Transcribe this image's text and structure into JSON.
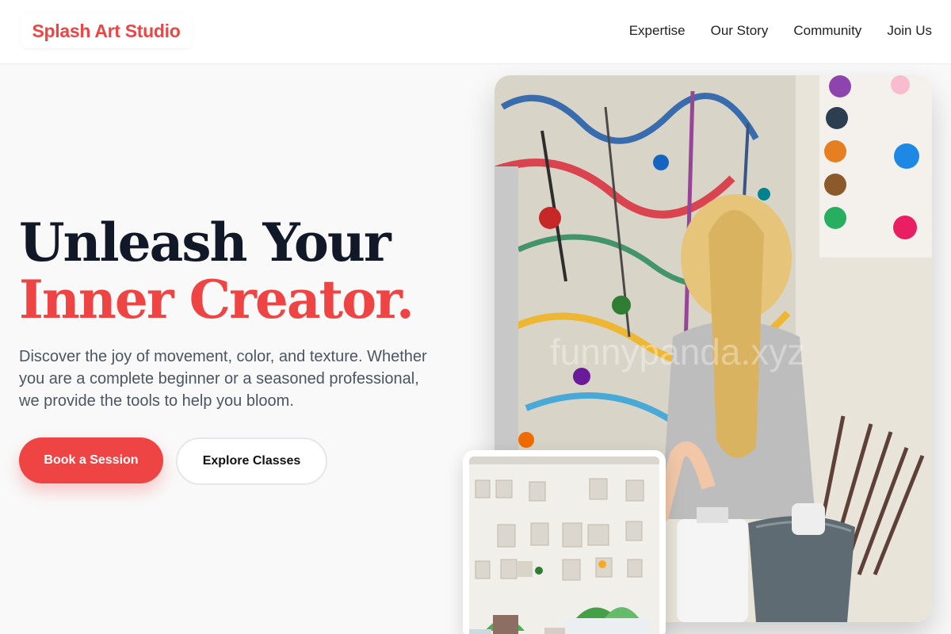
{
  "brand": {
    "name": "Splash Art Studio"
  },
  "nav": {
    "items": [
      "Expertise",
      "Our Story",
      "Community",
      "Join Us"
    ]
  },
  "hero": {
    "title_line1": "Unleash Your",
    "title_line2": "Inner Creator.",
    "subtitle": "Discover the joy of movement, color, and texture. Whether you are a complete beginner or a seasoned professional, we provide the tools to help you bloom.",
    "primary_cta": "Book a Session",
    "secondary_cta": "Explore Classes"
  },
  "images": {
    "main_watermark": "funnypanda.xyz"
  },
  "colors": {
    "accent": "#ef4444",
    "heading": "#111827",
    "body_text": "#4b5563"
  }
}
